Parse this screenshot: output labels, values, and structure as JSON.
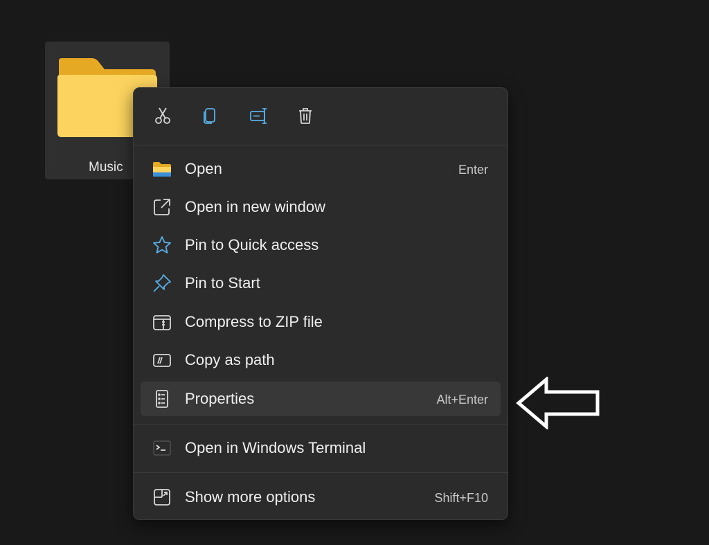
{
  "folder": {
    "label": "Music",
    "icon": "folder-icon",
    "color": "#f7c948"
  },
  "quick_actions": [
    {
      "name": "cut",
      "icon": "scissors-icon"
    },
    {
      "name": "copy",
      "icon": "copy-icon"
    },
    {
      "name": "rename",
      "icon": "rename-icon"
    },
    {
      "name": "delete",
      "icon": "trash-icon"
    }
  ],
  "menu": {
    "items": [
      {
        "label": "Open",
        "shortcut": "Enter",
        "icon": "folder-open-icon"
      },
      {
        "label": "Open in new window",
        "shortcut": "",
        "icon": "external-window-icon"
      },
      {
        "label": "Pin to Quick access",
        "shortcut": "",
        "icon": "star-icon"
      },
      {
        "label": "Pin to Start",
        "shortcut": "",
        "icon": "pin-icon"
      },
      {
        "label": "Compress to ZIP file",
        "shortcut": "",
        "icon": "zip-icon"
      },
      {
        "label": "Copy as path",
        "shortcut": "",
        "icon": "path-icon"
      },
      {
        "label": "Properties",
        "shortcut": "Alt+Enter",
        "icon": "properties-icon"
      },
      {
        "label": "Open in Windows Terminal",
        "shortcut": "",
        "icon": "terminal-icon"
      },
      {
        "label": "Show more options",
        "shortcut": "Shift+F10",
        "icon": "more-options-icon"
      }
    ],
    "highlighted": "Properties"
  },
  "colors": {
    "background": "#191919",
    "menu_background": "#2b2b2b",
    "accent_icon": "#5ab0e8",
    "annotation_arrow": "#ffffff"
  }
}
